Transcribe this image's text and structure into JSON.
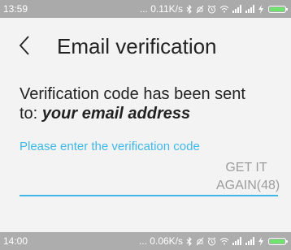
{
  "status_top": {
    "time": "13:59",
    "speed": "... 0.11K/s"
  },
  "status_bottom": {
    "time": "14:00",
    "speed": "... 0.06K/s"
  },
  "status_icons": [
    "bluetooth-icon",
    "mute-icon",
    "alarm-icon",
    "wifi-icon",
    "signal-icon",
    "signal-icon",
    "charging-icon",
    "battery-icon"
  ],
  "header": {
    "title": "Email verification",
    "back_icon": "chevron-left-icon"
  },
  "message": {
    "line1": "Verification code has been sent",
    "to_label": "to:",
    "address": "your email address"
  },
  "code_input": {
    "hint": "Please enter the verification code",
    "value": ""
  },
  "resend": {
    "label": "GET IT AGAIN(48)"
  },
  "colors": {
    "accent": "#3fb8e8",
    "status_bar": "#aaaaaa",
    "background": "#f3f3f3",
    "muted_text": "#9d9d9d",
    "battery": "#6ee36e"
  }
}
